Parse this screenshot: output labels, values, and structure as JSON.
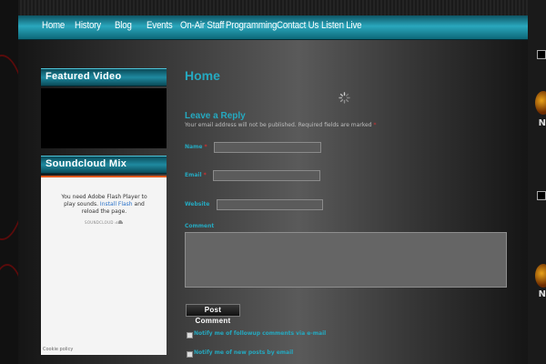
{
  "nav": {
    "items": [
      "Home",
      "History",
      "Blog",
      "Events",
      "On-Air Staff",
      "Programming",
      "Contact Us",
      "Listen Live"
    ]
  },
  "sidebar": {
    "featured_video_title": "Featured Video",
    "soundcloud_title": "Soundcloud Mix",
    "soundcloud": {
      "msg_prefix": "You need Adobe Flash Player to play sounds.",
      "install_link": "Install Flash",
      "msg_suffix": "and reload the page.",
      "logo": "SOUNDCLOUD",
      "cookie": "Cookie policy"
    }
  },
  "content": {
    "page_title": "Home",
    "reply_title": "Leave a Reply",
    "notes": "Your email address will not be published. Required fields are marked",
    "required_mark": "*",
    "fields": {
      "name_label": "Name",
      "email_label": "Email",
      "website_label": "Website",
      "comment_label": "Comment"
    },
    "post_button": "Post Comment",
    "notify_followup": "Notify me of followup comments via e-mail",
    "notify_posts": "Notify me of new posts by email"
  },
  "side_right": {
    "letter": "N"
  },
  "colors": {
    "accent": "#25a9c0",
    "nav": "#2aa7bd",
    "required": "#d03030",
    "soundcloud": "#e05a1e"
  }
}
